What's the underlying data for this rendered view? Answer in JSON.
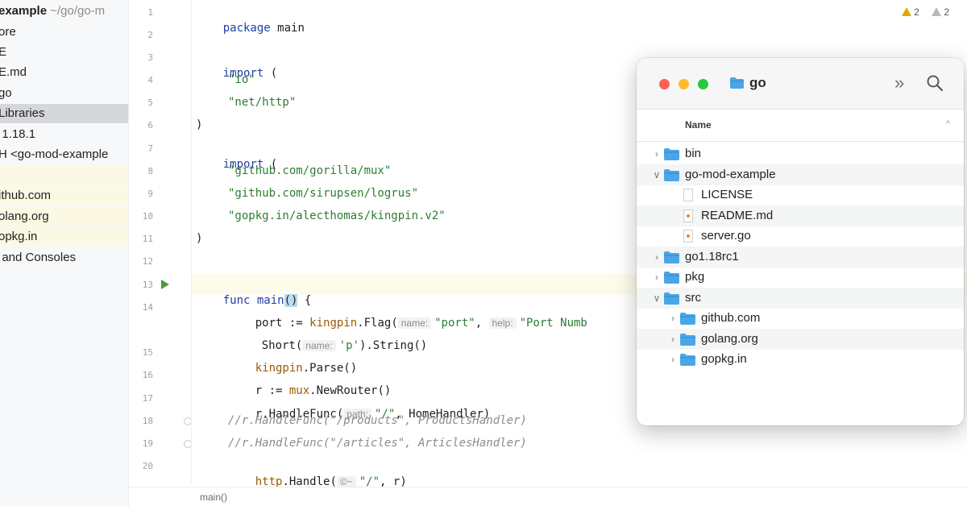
{
  "project": {
    "rows": [
      {
        "text": "example",
        "subtext": " ~/go/go-m",
        "bold": true
      },
      {
        "text": "ore"
      },
      {
        "text": "E"
      },
      {
        "text": "E.md"
      },
      {
        "text": "go"
      },
      {
        "text": "Libraries",
        "selected": true
      },
      {
        "text": "  1.18.1"
      },
      {
        "text": "H <go-mod-example"
      },
      {
        "text": ""
      },
      {
        "text": "ithub.com"
      },
      {
        "text": "olang.org"
      },
      {
        "text": "opkg.in"
      },
      {
        "text": "  and Consoles"
      }
    ]
  },
  "editor": {
    "inspections": {
      "warnings": "2",
      "weak_warnings": "2"
    },
    "breadcrumb": "main()",
    "line_numbers": [
      "1",
      "2",
      "3",
      "4",
      "5",
      "6",
      "7",
      "8",
      "9",
      "10",
      "11",
      "12",
      "13",
      "14",
      "",
      "15",
      "16",
      "17",
      "18",
      "19",
      "20"
    ],
    "code": {
      "l1_kw": "package",
      "l1_name": " main",
      "l3_kw": "import",
      "l3_rest": " (",
      "l4_str": "\"io\"",
      "l5_str": "\"net/http\"",
      "l6": ")",
      "l7_kw": "import",
      "l7_rest": " (",
      "l8_str": "\"github.com/gorilla/mux\"",
      "l9_str": "\"github.com/sirupsen/logrus\"",
      "l10_str": "\"gopkg.in/alecthomas/kingpin.v2\"",
      "l11": ")",
      "l13_kw": "func",
      "l13_fn": " main",
      "l13_parens": "()",
      "l13_rest": " {",
      "l14_a": "port := ",
      "l14_pkg": "kingpin",
      "l14_b": ".Flag(",
      "l14_hint1": "name:",
      "l14_s1": "\"port\"",
      "l14_c": ", ",
      "l14_hint2": "help:",
      "l14_s2": "\"Port Numb",
      "l14w_a": "Short(",
      "l14w_hint": "name:",
      "l14w_s": "'p'",
      "l14w_b": ").String()",
      "l15_pkg": "kingpin",
      "l15_b": ".Parse()",
      "l16_a": "r := ",
      "l16_pkg": "mux",
      "l16_b": ".NewRouter()",
      "l17_a": "r.HandleFunc(",
      "l17_hint": "path:",
      "l17_s": "\"/\"",
      "l17_b": ", HomeHandler)",
      "l18_cmt": "//r.HandleFunc(\"/products\", ProductsHandler)",
      "l19_cmt": "//r.HandleFunc(\"/articles\", ArticlesHandler)",
      "l20_pkg": "http",
      "l20_b": ".Handle(",
      "l20_hint": "©~",
      "l20_s": "\"/\"",
      "l20_c": ", r)"
    }
  },
  "finder": {
    "title": "go",
    "more_label": "»",
    "column_header": "Name",
    "sort_indicator": "^",
    "items": [
      {
        "label": "bin",
        "kind": "folder",
        "depth": 0,
        "disclosure": "closed"
      },
      {
        "label": "go-mod-example",
        "kind": "folder",
        "depth": 0,
        "disclosure": "open"
      },
      {
        "label": "LICENSE",
        "kind": "file",
        "depth": 1
      },
      {
        "label": "README.md",
        "kind": "md",
        "depth": 1
      },
      {
        "label": "server.go",
        "kind": "go",
        "depth": 1
      },
      {
        "label": "go1.18rc1",
        "kind": "folder",
        "depth": 0,
        "disclosure": "closed"
      },
      {
        "label": "pkg",
        "kind": "folder",
        "depth": 0,
        "disclosure": "closed"
      },
      {
        "label": "src",
        "kind": "folder",
        "depth": 0,
        "disclosure": "open"
      },
      {
        "label": "github.com",
        "kind": "folder",
        "depth": 1,
        "disclosure": "closed"
      },
      {
        "label": "golang.org",
        "kind": "folder",
        "depth": 1,
        "disclosure": "closed"
      },
      {
        "label": "gopkg.in",
        "kind": "folder",
        "depth": 1,
        "disclosure": "closed"
      }
    ],
    "icons": {
      "more": "chevrons-right-icon",
      "search": "search-icon",
      "folder": "folder-icon",
      "file": "file-icon"
    }
  },
  "colors": {
    "keyword": "#1f3fa5",
    "string": "#2e7d32",
    "package": "#9c5a00",
    "comment": "#8c8c8c",
    "selection": "#d5d7dc",
    "folder_blue": "#4aa6e8",
    "run_green": "#4c9a3b",
    "traffic_close": "#ff5f57",
    "traffic_minimize": "#febc2e",
    "traffic_zoom": "#28c840"
  }
}
